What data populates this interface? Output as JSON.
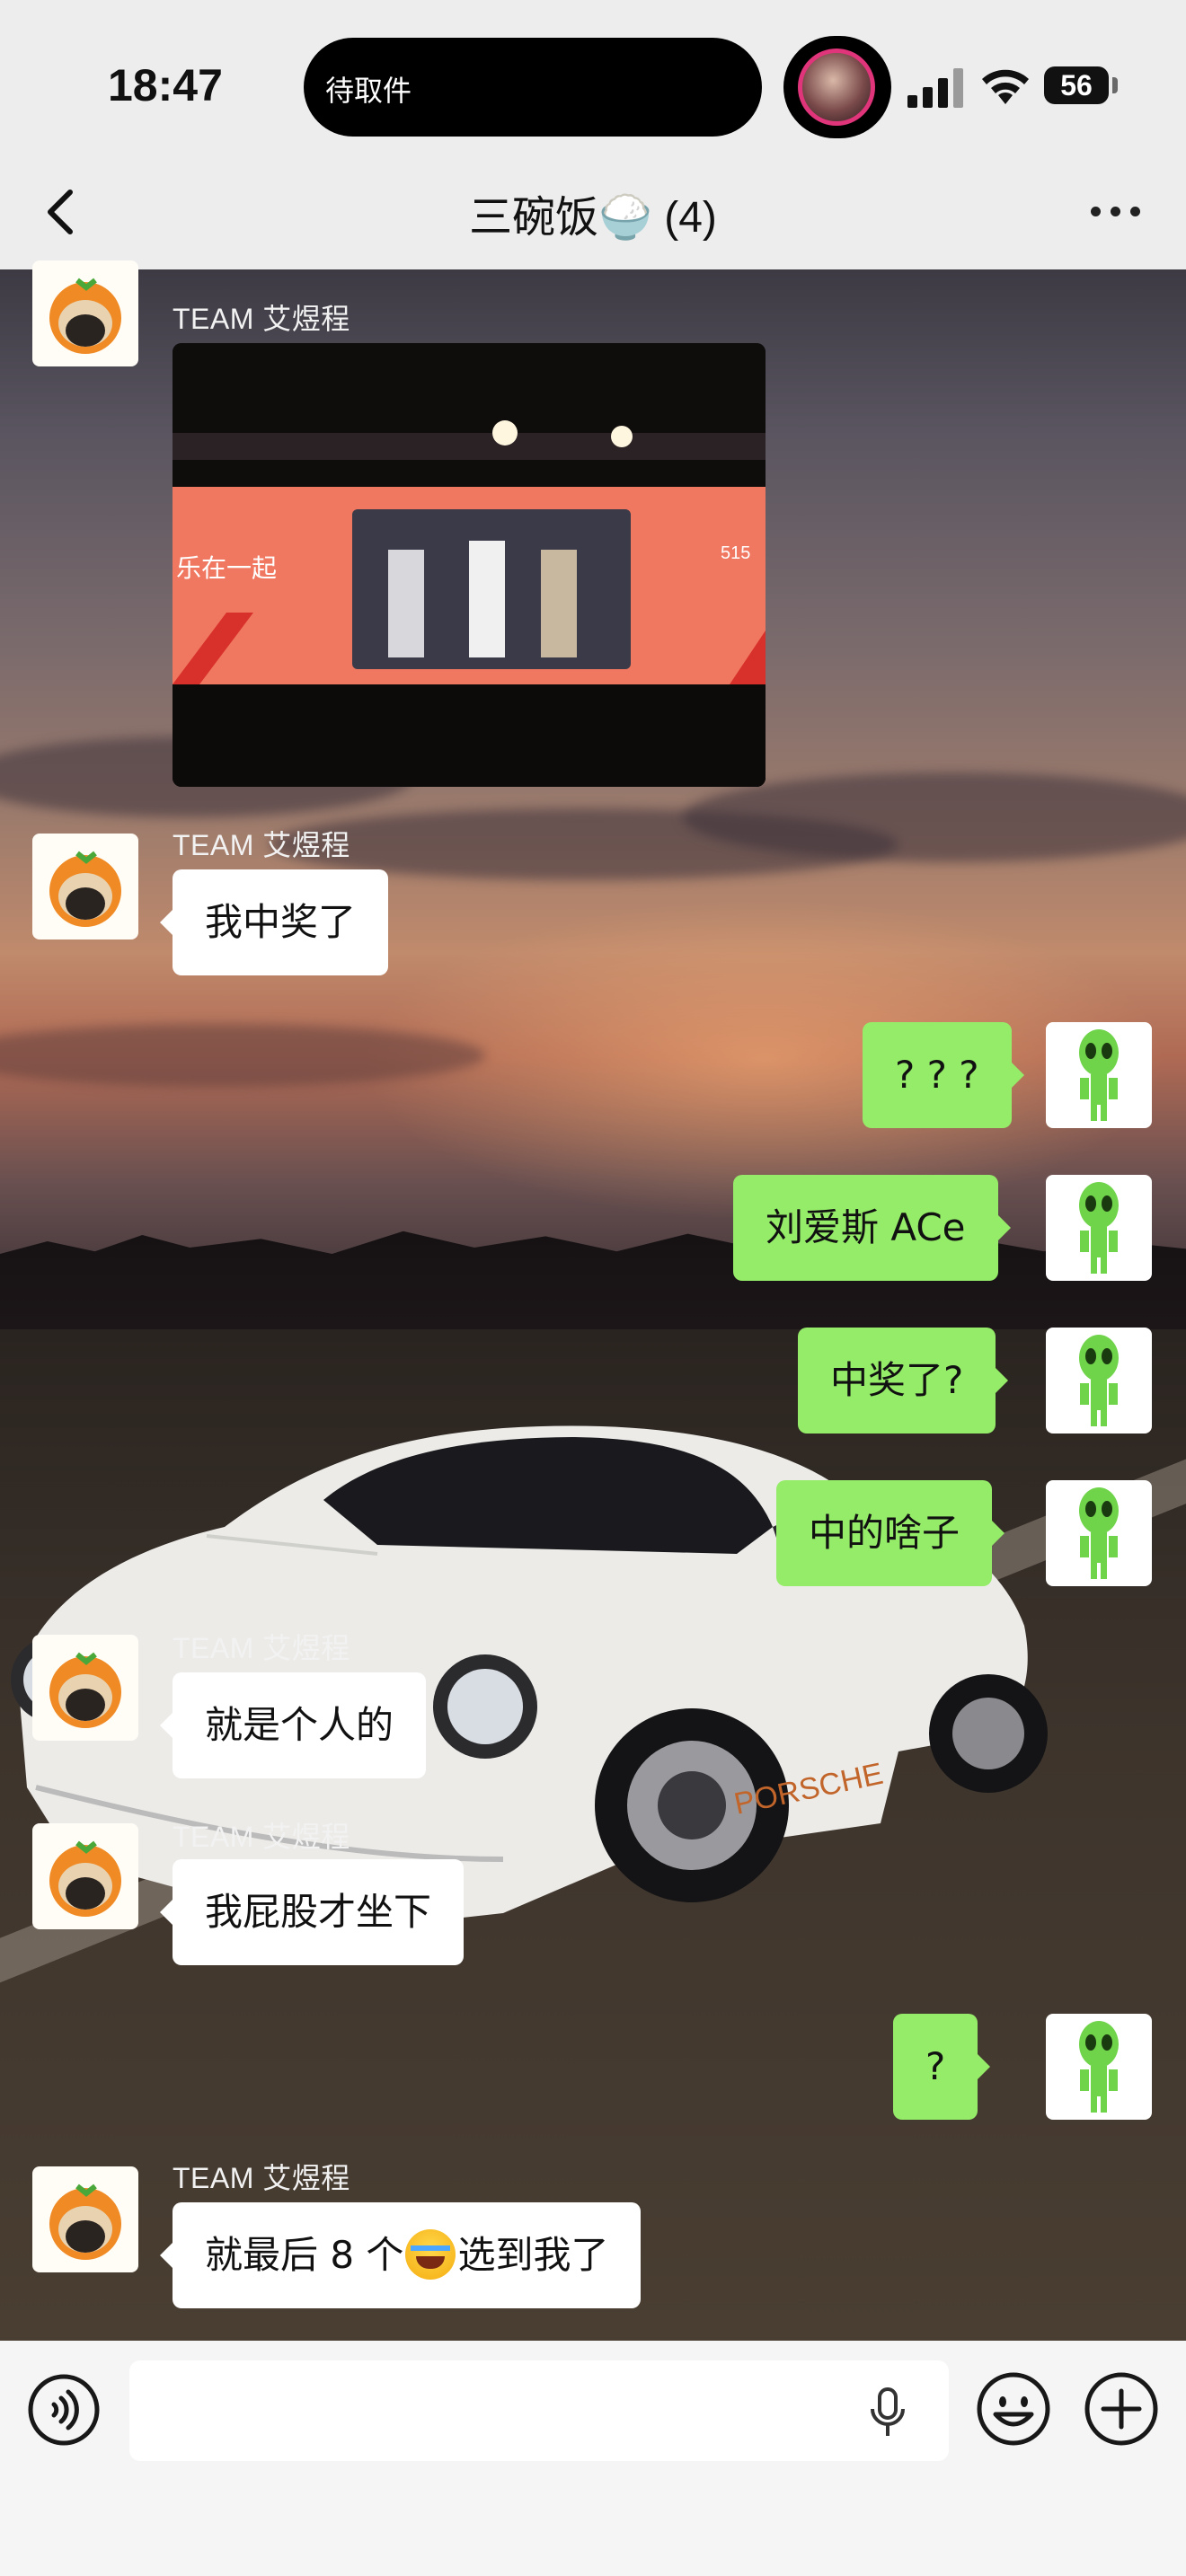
{
  "status_bar": {
    "time": "18:47",
    "island_text": "待取件",
    "battery": "56"
  },
  "nav": {
    "title": "三碗饭🍚 (4)"
  },
  "messages": [
    {
      "sender": "TEAM 艾煜程",
      "type": "image"
    },
    {
      "sender": "TEAM 艾煜程",
      "text": "我中奖了"
    },
    {
      "text": "? ? ?"
    },
    {
      "text": "刘爱斯 ACe"
    },
    {
      "text": "中奖了?"
    },
    {
      "text": "中的啥子"
    },
    {
      "sender": "TEAM 艾煜程",
      "text": "就是个人的"
    },
    {
      "sender": "TEAM 艾煜程",
      "text": "我屁股才坐下"
    },
    {
      "text": "?"
    },
    {
      "sender": "TEAM 艾煜程",
      "text_before": "就最后 8 个",
      "text_after": "选到我了"
    }
  ],
  "photo": {
    "screen_left_text": "乐在一起",
    "screen_right_text": "515"
  },
  "car_brand": "PORSCHE",
  "colors": {
    "bubble_out": "#95ec69",
    "bubble_in": "#ffffff",
    "top_bar": "#ededed",
    "input_bar": "#f5f5f5"
  }
}
